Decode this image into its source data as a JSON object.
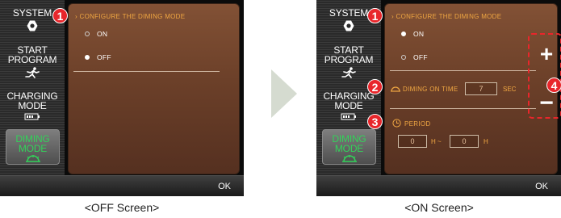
{
  "off_screen": {
    "sidebar": [
      "SYSTEM",
      "START\nPROGRAM",
      "CHARGING\nMODE",
      "DIMING\nMODE"
    ],
    "title": "› CONFIGURE THE DIMING MODE",
    "options": [
      {
        "label": "ON",
        "selected": false
      },
      {
        "label": "OFF",
        "selected": true
      }
    ],
    "ok": "OK"
  },
  "on_screen": {
    "sidebar": [
      "SYSTEM",
      "START\nPROGRAM",
      "CHARGING\nMODE",
      "DIMING\nMODE"
    ],
    "title": "› CONFIGURE THE DIMING MODE",
    "options": [
      {
        "label": "ON",
        "selected": true
      },
      {
        "label": "OFF",
        "selected": false
      }
    ],
    "diming_on_time": {
      "label": "DIMING ON TIME",
      "value": "7",
      "unit": "SEC"
    },
    "period": {
      "label": "PERIOD",
      "start": "0",
      "start_unit": "H ~",
      "end": "0",
      "end_unit": "H"
    },
    "plus": "+",
    "minus": "−",
    "ok": "OK"
  },
  "badges": [
    "1",
    "2",
    "3",
    "4"
  ],
  "captions": {
    "off": "<OFF Screen>",
    "on": "<ON Screen>"
  },
  "colors": {
    "accent": "#f0a742",
    "badge": "#e8262b",
    "selected_mode": "#33d25a",
    "panel": "#6c4029"
  },
  "icons": [
    "gear-icon",
    "runner-icon",
    "battery-icon",
    "dimming-lamp-icon",
    "clock-icon"
  ]
}
